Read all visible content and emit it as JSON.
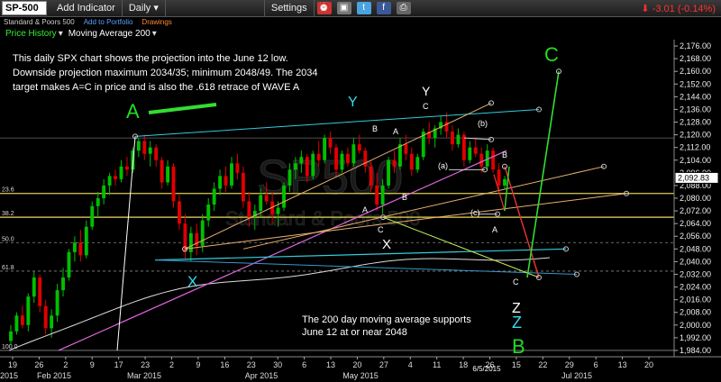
{
  "toolbar": {
    "symbol": "SP-500",
    "add_indicator": "Add Indicator",
    "period": "Daily",
    "settings": "Settings",
    "change": "-3.01 (-0.14%)"
  },
  "subbar": {
    "name": "Standard & Poors 500",
    "add_portfolio": "Add to Portfolio",
    "drawings": "Drawings"
  },
  "indicators": {
    "price_history": "Price History",
    "moving_average": "Moving Average 200"
  },
  "watermark": "SP500",
  "watermark_sub": "Standard & Poors 500",
  "colors": {
    "background": "#000000",
    "up": "#00c000",
    "down": "#e00000",
    "annotation_green": "#22dd22",
    "annotation_cyan": "#33ddee"
  },
  "chart_data": {
    "type": "candlestick",
    "y_ticks": [
      1984,
      1992,
      2000,
      2008,
      2016,
      2024,
      2032,
      2040,
      2048,
      2056,
      2064,
      2072,
      2080,
      2088,
      2096,
      2104,
      2112,
      2120,
      2128,
      2136,
      2144,
      2152,
      2160,
      2168,
      2176
    ],
    "y_tick_labels": [
      "1,984.00",
      "1,992.00",
      "2,000.00",
      "2,008.00",
      "2,016.00",
      "2,024.00",
      "2,032.00",
      "2,040.00",
      "2,048.00",
      "2,056.00",
      "2,064.00",
      "2,072.00",
      "2,080.00",
      "2,088.00",
      "2,096.00",
      "2,104.00",
      "2,112.00",
      "2,120.00",
      "2,128.00",
      "2,136.00",
      "2,144.00",
      "2,152.00",
      "2,160.00",
      "2,168.00",
      "2,176.00"
    ],
    "ylim": [
      1980,
      2180
    ],
    "current_price": "2,092.83",
    "x_ticks": [
      "2015",
      "26",
      "Feb 2015",
      "2",
      "9",
      "17",
      "23",
      "Mar 2015",
      "2",
      "9",
      "16",
      "23",
      "30",
      "Apr 2015",
      "6",
      "13",
      "20",
      "27",
      "May 2015",
      "4",
      "11",
      "18",
      "26",
      "6/5/2015",
      "15",
      "22",
      "29",
      "Jul 2015",
      "6",
      "13",
      "20"
    ],
    "x_ticks_top": [
      "19",
      "26",
      "2",
      "9",
      "17",
      "23",
      "2",
      "9",
      "16",
      "23",
      "30",
      "6",
      "13",
      "20",
      "27",
      "4",
      "11",
      "18",
      "26",
      "15",
      "22",
      "29",
      "6",
      "13",
      "20"
    ],
    "x_ticks_bottom": [
      "2015",
      "Feb 2015",
      "Mar 2015",
      "Apr 2015",
      "May 2015",
      "Jul 2015"
    ],
    "date_label": "6/5/2015",
    "fib_levels": [
      {
        "label": "23.6",
        "value": 2083
      },
      {
        "label": "38.2",
        "value": 2068
      },
      {
        "label": "50.0",
        "value": 2052
      },
      {
        "label": "61.8",
        "value": 2034
      },
      {
        "label": "100.0",
        "value": 1984
      }
    ],
    "candles": [
      {
        "o": 1990,
        "h": 2000,
        "l": 1988,
        "c": 1996
      },
      {
        "o": 1996,
        "h": 2008,
        "l": 1994,
        "c": 2006
      },
      {
        "o": 2006,
        "h": 2012,
        "l": 1998,
        "c": 2000
      },
      {
        "o": 2000,
        "h": 2020,
        "l": 1996,
        "c": 2018
      },
      {
        "o": 2018,
        "h": 2034,
        "l": 2014,
        "c": 2030
      },
      {
        "o": 2030,
        "h": 2032,
        "l": 2008,
        "c": 2012
      },
      {
        "o": 2012,
        "h": 2016,
        "l": 1994,
        "c": 1998
      },
      {
        "o": 1998,
        "h": 2010,
        "l": 1992,
        "c": 2006
      },
      {
        "o": 2006,
        "h": 2026,
        "l": 2002,
        "c": 2022
      },
      {
        "o": 2022,
        "h": 2036,
        "l": 2018,
        "c": 2030
      },
      {
        "o": 2030,
        "h": 2048,
        "l": 2028,
        "c": 2046
      },
      {
        "o": 2046,
        "h": 2056,
        "l": 2040,
        "c": 2052
      },
      {
        "o": 2052,
        "h": 2060,
        "l": 2040,
        "c": 2044
      },
      {
        "o": 2044,
        "h": 2066,
        "l": 2042,
        "c": 2062
      },
      {
        "o": 2062,
        "h": 2078,
        "l": 2060,
        "c": 2075
      },
      {
        "o": 2075,
        "h": 2084,
        "l": 2068,
        "c": 2080
      },
      {
        "o": 2080,
        "h": 2092,
        "l": 2076,
        "c": 2088
      },
      {
        "o": 2088,
        "h": 2096,
        "l": 2082,
        "c": 2094
      },
      {
        "o": 2094,
        "h": 2098,
        "l": 2088,
        "c": 2092
      },
      {
        "o": 2092,
        "h": 2104,
        "l": 2090,
        "c": 2100
      },
      {
        "o": 2100,
        "h": 2106,
        "l": 2094,
        "c": 2098
      },
      {
        "o": 2098,
        "h": 2112,
        "l": 2096,
        "c": 2110
      },
      {
        "o": 2110,
        "h": 2118,
        "l": 2106,
        "c": 2116
      },
      {
        "o": 2116,
        "h": 2120,
        "l": 2104,
        "c": 2108
      },
      {
        "o": 2108,
        "h": 2116,
        "l": 2100,
        "c": 2112
      },
      {
        "o": 2112,
        "h": 2114,
        "l": 2100,
        "c": 2104
      },
      {
        "o": 2104,
        "h": 2106,
        "l": 2086,
        "c": 2090
      },
      {
        "o": 2090,
        "h": 2104,
        "l": 2088,
        "c": 2100
      },
      {
        "o": 2100,
        "h": 2102,
        "l": 2074,
        "c": 2078
      },
      {
        "o": 2078,
        "h": 2082,
        "l": 2060,
        "c": 2064
      },
      {
        "o": 2064,
        "h": 2070,
        "l": 2042,
        "c": 2046
      },
      {
        "o": 2046,
        "h": 2062,
        "l": 2040,
        "c": 2058
      },
      {
        "o": 2058,
        "h": 2064,
        "l": 2044,
        "c": 2050
      },
      {
        "o": 2050,
        "h": 2070,
        "l": 2046,
        "c": 2066
      },
      {
        "o": 2066,
        "h": 2080,
        "l": 2062,
        "c": 2076
      },
      {
        "o": 2076,
        "h": 2090,
        "l": 2072,
        "c": 2086
      },
      {
        "o": 2086,
        "h": 2098,
        "l": 2082,
        "c": 2094
      },
      {
        "o": 2094,
        "h": 2100,
        "l": 2084,
        "c": 2088
      },
      {
        "o": 2088,
        "h": 2106,
        "l": 2086,
        "c": 2102
      },
      {
        "o": 2102,
        "h": 2108,
        "l": 2092,
        "c": 2096
      },
      {
        "o": 2096,
        "h": 2100,
        "l": 2074,
        "c": 2078
      },
      {
        "o": 2078,
        "h": 2084,
        "l": 2062,
        "c": 2068
      },
      {
        "o": 2068,
        "h": 2076,
        "l": 2060,
        "c": 2072
      },
      {
        "o": 2072,
        "h": 2086,
        "l": 2068,
        "c": 2082
      },
      {
        "o": 2082,
        "h": 2090,
        "l": 2076,
        "c": 2078
      },
      {
        "o": 2078,
        "h": 2084,
        "l": 2064,
        "c": 2070
      },
      {
        "o": 2070,
        "h": 2078,
        "l": 2062,
        "c": 2074
      },
      {
        "o": 2074,
        "h": 2090,
        "l": 2072,
        "c": 2088
      },
      {
        "o": 2088,
        "h": 2102,
        "l": 2084,
        "c": 2098
      },
      {
        "o": 2098,
        "h": 2106,
        "l": 2092,
        "c": 2102
      },
      {
        "o": 2102,
        "h": 2110,
        "l": 2096,
        "c": 2106
      },
      {
        "o": 2106,
        "h": 2108,
        "l": 2090,
        "c": 2094
      },
      {
        "o": 2094,
        "h": 2110,
        "l": 2092,
        "c": 2108
      },
      {
        "o": 2108,
        "h": 2116,
        "l": 2100,
        "c": 2104
      },
      {
        "o": 2104,
        "h": 2120,
        "l": 2102,
        "c": 2118
      },
      {
        "o": 2118,
        "h": 2122,
        "l": 2108,
        "c": 2112
      },
      {
        "o": 2112,
        "h": 2114,
        "l": 2094,
        "c": 2098
      },
      {
        "o": 2098,
        "h": 2110,
        "l": 2096,
        "c": 2108
      },
      {
        "o": 2108,
        "h": 2112,
        "l": 2100,
        "c": 2102
      },
      {
        "o": 2102,
        "h": 2118,
        "l": 2100,
        "c": 2114
      },
      {
        "o": 2114,
        "h": 2120,
        "l": 2108,
        "c": 2110
      },
      {
        "o": 2110,
        "h": 2112,
        "l": 2096,
        "c": 2100
      },
      {
        "o": 2100,
        "h": 2104,
        "l": 2084,
        "c": 2088
      },
      {
        "o": 2088,
        "h": 2096,
        "l": 2072,
        "c": 2076
      },
      {
        "o": 2076,
        "h": 2092,
        "l": 2070,
        "c": 2088
      },
      {
        "o": 2088,
        "h": 2106,
        "l": 2086,
        "c": 2104
      },
      {
        "o": 2104,
        "h": 2110,
        "l": 2096,
        "c": 2100
      },
      {
        "o": 2100,
        "h": 2118,
        "l": 2098,
        "c": 2114
      },
      {
        "o": 2114,
        "h": 2120,
        "l": 2104,
        "c": 2108
      },
      {
        "o": 2108,
        "h": 2112,
        "l": 2094,
        "c": 2098
      },
      {
        "o": 2098,
        "h": 2108,
        "l": 2096,
        "c": 2106
      },
      {
        "o": 2106,
        "h": 2124,
        "l": 2104,
        "c": 2122
      },
      {
        "o": 2122,
        "h": 2128,
        "l": 2114,
        "c": 2118
      },
      {
        "o": 2118,
        "h": 2126,
        "l": 2112,
        "c": 2124
      },
      {
        "o": 2124,
        "h": 2132,
        "l": 2120,
        "c": 2128
      },
      {
        "o": 2128,
        "h": 2134,
        "l": 2118,
        "c": 2122
      },
      {
        "o": 2122,
        "h": 2126,
        "l": 2110,
        "c": 2114
      },
      {
        "o": 2114,
        "h": 2124,
        "l": 2112,
        "c": 2120
      },
      {
        "o": 2120,
        "h": 2122,
        "l": 2100,
        "c": 2104
      },
      {
        "o": 2104,
        "h": 2116,
        "l": 2102,
        "c": 2112
      },
      {
        "o": 2112,
        "h": 2118,
        "l": 2106,
        "c": 2108
      },
      {
        "o": 2108,
        "h": 2112,
        "l": 2096,
        "c": 2100
      },
      {
        "o": 2100,
        "h": 2114,
        "l": 2098,
        "c": 2110
      },
      {
        "o": 2110,
        "h": 2112,
        "l": 2096,
        "c": 2098
      },
      {
        "o": 2098,
        "h": 2102,
        "l": 2084,
        "c": 2088
      },
      {
        "o": 2088,
        "h": 2094,
        "l": 2086,
        "c": 2092
      }
    ],
    "annotations": {
      "big_a": "A",
      "big_c": "C",
      "big_b": "B",
      "x1": "X",
      "x2": "X",
      "y1": "Y",
      "y2": "Y",
      "z1": "Z",
      "z2": "Z",
      "small": [
        "C",
        "B",
        "A",
        "B",
        "C",
        "(b)",
        "(a)",
        "B",
        "A",
        "(c)",
        "A",
        "C",
        "B",
        "C"
      ],
      "text_top": "This daily SPX chart shows the projection into the June 12 low. Downside projection maximum 2034/35; minimum 2048/49. The 2034 target makes A=C in price and is also the .618 retrace of WAVE A",
      "text_top_lines": [
        "This daily SPX chart shows the projection into the June 12 low.",
        "Downside projection maximum 2034/35; minimum 2048/49. The 2034",
        "target makes A=C in price and is also the .618 retrace of WAVE A"
      ],
      "text_bottom_lines": [
        "The 200 day moving average supports",
        "June 12 at or near 2048"
      ]
    }
  }
}
